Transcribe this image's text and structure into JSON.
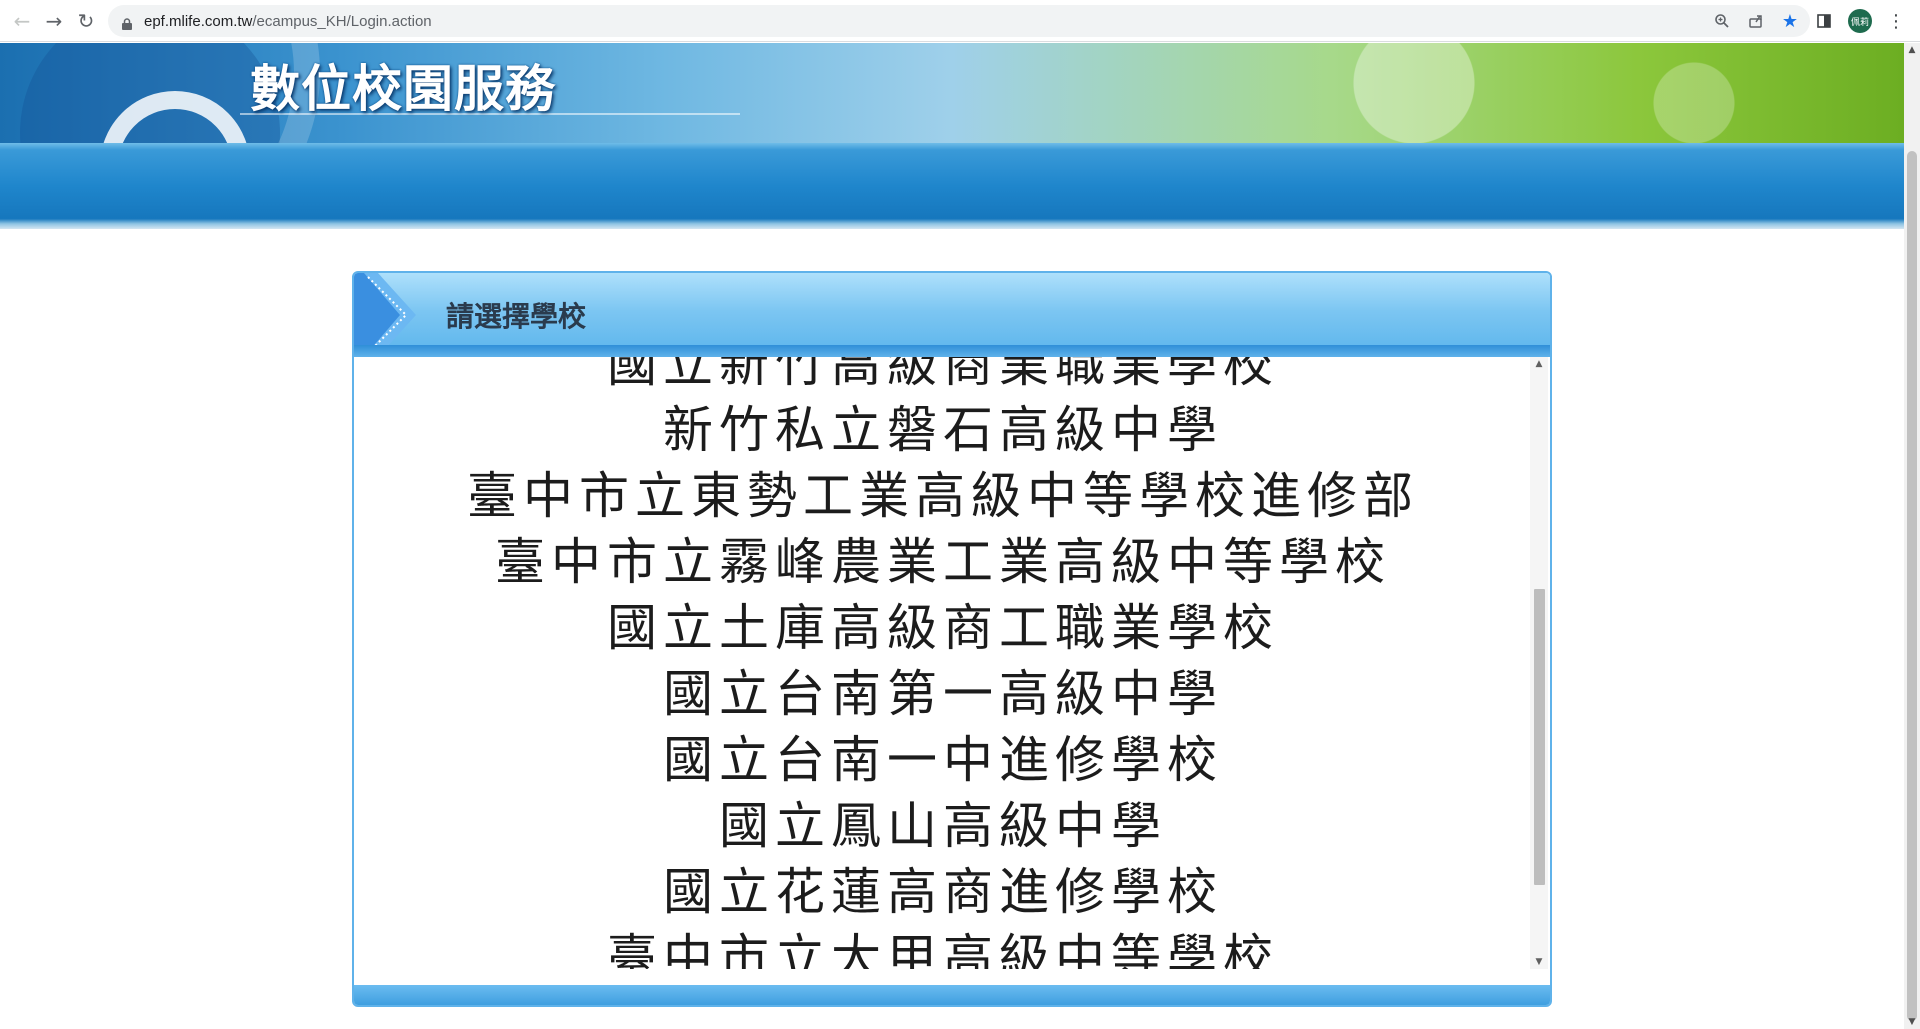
{
  "browser": {
    "url_host": "epf.mlife.com.tw",
    "url_path": "/ecampus_KH/Login.action",
    "avatar_text": "佩莉",
    "icons": [
      "back-icon",
      "forward-icon",
      "reload-icon",
      "lock-icon",
      "zoom-icon",
      "share-icon",
      "bookmark-star-icon",
      "side-panel-icon",
      "menu-icon"
    ]
  },
  "banner": {
    "title": "數位校園服務"
  },
  "dialog": {
    "title": "請選擇學校",
    "schools": [
      "國立新竹高級商業職業學校",
      "新竹私立磐石高級中學",
      "臺中市立東勢工業高級中等學校進修部",
      "臺中市立霧峰農業工業高級中等學校",
      "國立土庫高級商工職業學校",
      "國立台南第一高級中學",
      "國立台南一中進修學校",
      "國立鳳山高級中學",
      "國立花蓮高商進修學校",
      "臺中市立大甲高級中等學校"
    ]
  },
  "colors": {
    "accent": "#1f86cc",
    "dialog_border": "#5fb2ea"
  }
}
